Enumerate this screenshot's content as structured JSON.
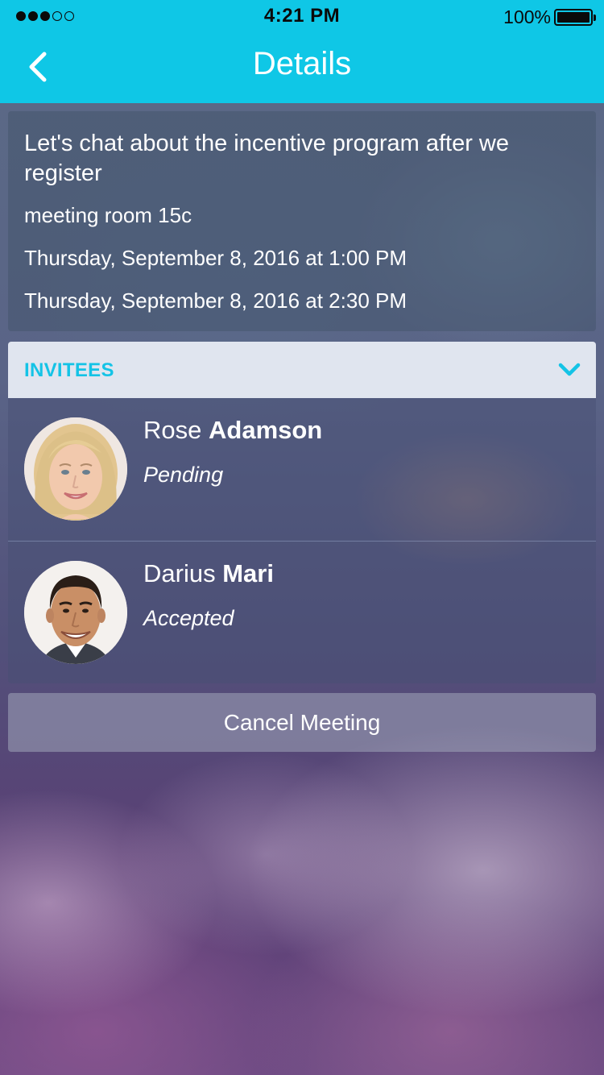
{
  "status_bar": {
    "time": "4:21 PM",
    "battery": "100%",
    "signal_strength": 3,
    "signal_max": 5
  },
  "nav": {
    "title": "Details",
    "back_icon": "chevron-left-icon"
  },
  "event": {
    "title": "Let's chat about the incentive program after we register",
    "location": "meeting room 15c",
    "start": "Thursday, September 8, 2016 at 1:00 PM",
    "end": "Thursday, September 8, 2016 at 2:30 PM"
  },
  "invitees": {
    "label": "INVITEES",
    "toggle_icon": "chevron-down-icon",
    "items": [
      {
        "first_name": "Rose",
        "last_name": "Adamson",
        "status": "Pending"
      },
      {
        "first_name": "Darius",
        "last_name": "Mari",
        "status": "Accepted"
      }
    ]
  },
  "actions": {
    "cancel_label": "Cancel Meeting"
  },
  "colors": {
    "accent": "#0fc7e6",
    "invitees_label": "#14c3e6",
    "text_light": "#ffffff"
  }
}
